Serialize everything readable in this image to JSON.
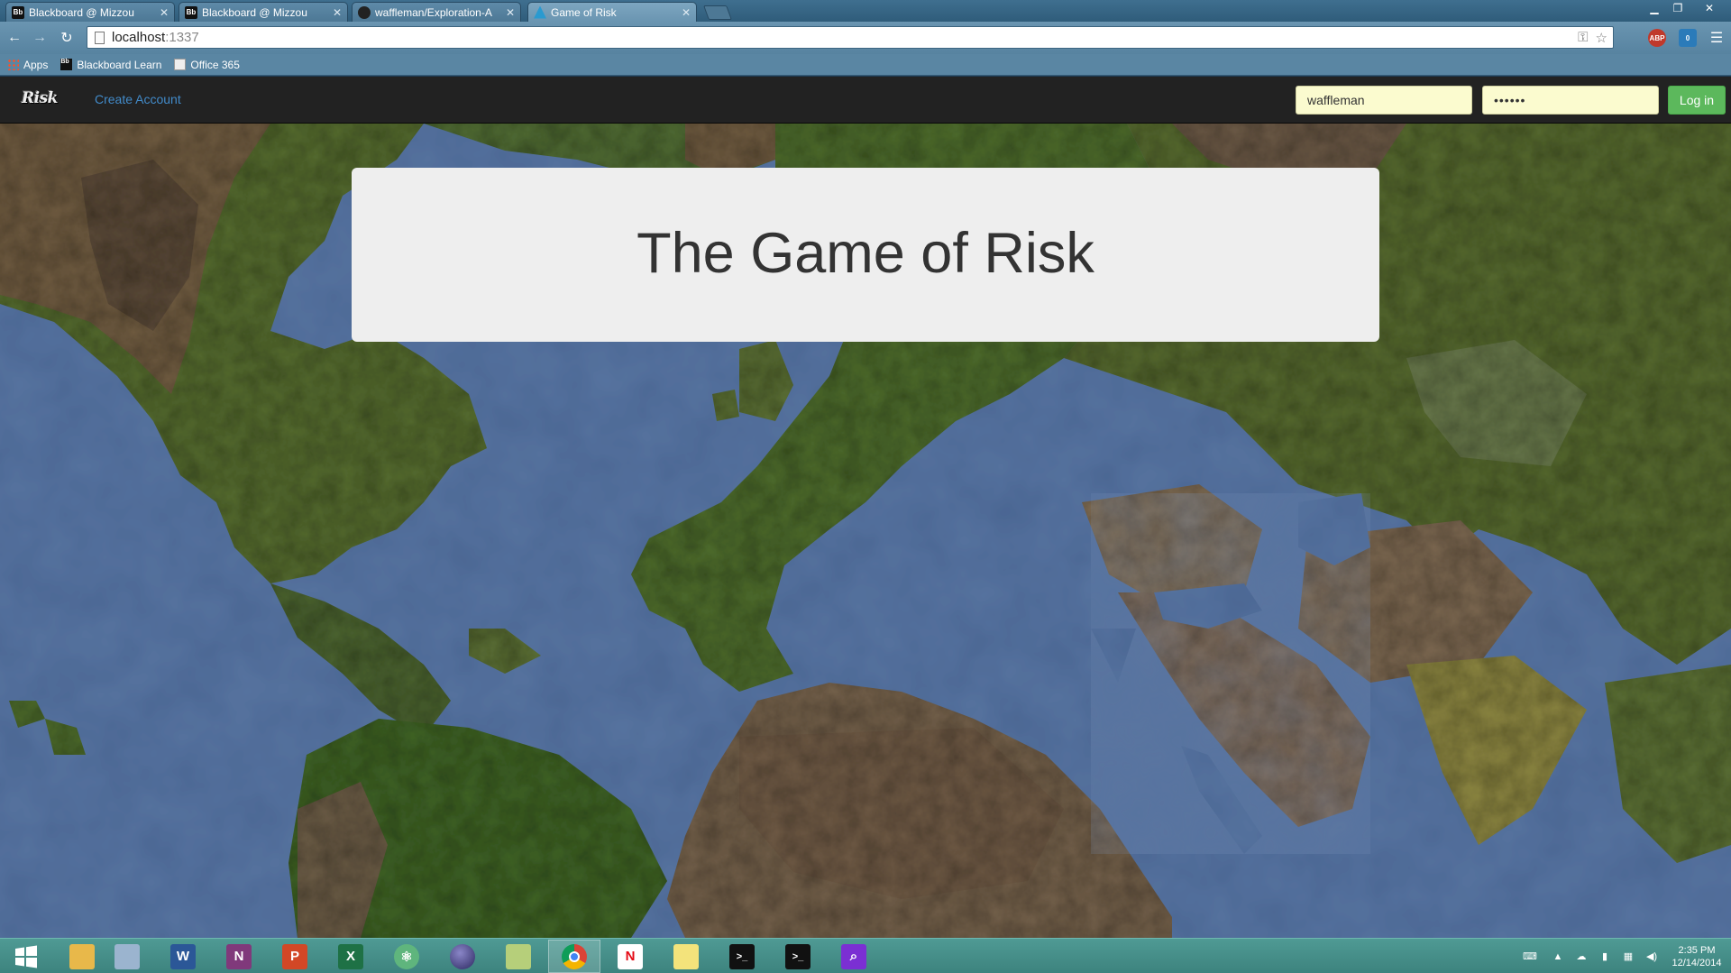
{
  "browser": {
    "tabs": [
      {
        "title": "Blackboard @ Mizzou",
        "favicon": "blackboard-icon",
        "active": false
      },
      {
        "title": "Blackboard @ Mizzou",
        "favicon": "blackboard-icon",
        "active": false
      },
      {
        "title": "waffleman/Exploration-A",
        "favicon": "github-icon",
        "active": false
      },
      {
        "title": "Game of Risk",
        "favicon": "risk-icon",
        "active": true
      }
    ],
    "address": {
      "host": "localhost",
      "port": ":1337"
    },
    "bookmarks": [
      {
        "label": "Apps",
        "icon": "apps-grid-icon"
      },
      {
        "label": "Blackboard Learn",
        "icon": "blackboard-icon"
      },
      {
        "label": "Office 365",
        "icon": "office-icon"
      }
    ],
    "extensions": {
      "abp": "ABP",
      "badge_count": "0"
    }
  },
  "navbar": {
    "brand": "Risk",
    "create_account": "Create Account",
    "username_value": "waffleman",
    "password_value": "••••••",
    "login_label": "Log in"
  },
  "hero": {
    "title": "The Game of Risk"
  },
  "taskbar": {
    "apps": [
      {
        "name": "start-button",
        "color": "#3d837e"
      },
      {
        "name": "file-explorer",
        "color": "#e8b84a"
      },
      {
        "name": "calculator",
        "color": "#9bb4cf"
      },
      {
        "name": "word",
        "label": "W",
        "color": "#2b5797"
      },
      {
        "name": "onenote",
        "label": "N",
        "color": "#80397b"
      },
      {
        "name": "powerpoint",
        "label": "P",
        "color": "#d24726"
      },
      {
        "name": "excel",
        "label": "X",
        "color": "#1e7145"
      },
      {
        "name": "atom",
        "color": "#5fb57d"
      },
      {
        "name": "eclipse",
        "color": "#47437e"
      },
      {
        "name": "notepad-plus",
        "color": "#b6cf7a"
      },
      {
        "name": "chrome",
        "color": "#dd4b39"
      },
      {
        "name": "netflix",
        "label": "N",
        "color": "#e50914"
      },
      {
        "name": "sticky-notes",
        "color": "#f3e37b"
      },
      {
        "name": "terminal-1",
        "label": ">_",
        "color": "#111111"
      },
      {
        "name": "terminal-2",
        "label": ">_",
        "color": "#111111"
      },
      {
        "name": "search-app",
        "color": "#7b2fd3"
      }
    ],
    "clock_time": "2:35 PM",
    "clock_date": "12/14/2014"
  }
}
